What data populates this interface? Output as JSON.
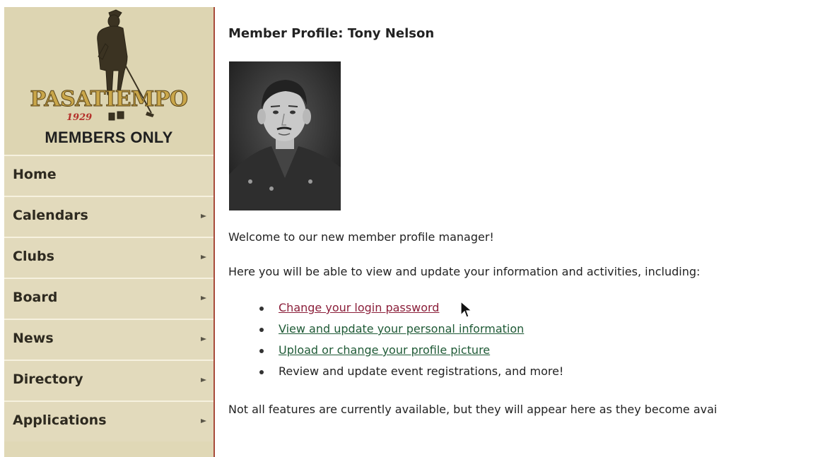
{
  "sidebar": {
    "logo": {
      "wordmark": "PASATIEMPO",
      "year": "1929"
    },
    "members_only": "MEMBERS ONLY",
    "items": [
      {
        "label": "Home",
        "has_submenu": false
      },
      {
        "label": "Calendars",
        "has_submenu": true
      },
      {
        "label": "Clubs",
        "has_submenu": true
      },
      {
        "label": "Board",
        "has_submenu": true
      },
      {
        "label": "News",
        "has_submenu": true
      },
      {
        "label": "Directory",
        "has_submenu": true
      },
      {
        "label": "Applications",
        "has_submenu": true
      }
    ]
  },
  "main": {
    "title": "Member Profile: Tony Nelson",
    "welcome": "Welcome to our new member profile manager!",
    "intro": "Here you will be able to view and update your information and activities, including:",
    "features": [
      {
        "text": "Change your login password",
        "link": true,
        "state": "hover"
      },
      {
        "text": "View and update your personal information",
        "link": true,
        "state": "normal"
      },
      {
        "text": "Upload or change your profile picture",
        "link": true,
        "state": "normal"
      },
      {
        "text": "Review and update event registrations, and more!",
        "link": false,
        "state": "normal"
      }
    ],
    "footer_note": "Not all features are currently available, but they will appear here as they become avai"
  },
  "colors": {
    "sidebar_bg": "#e0d8b6",
    "sidebar_border": "#a84a3a",
    "link_hover": "#8b1f3a",
    "link": "#1f5a36"
  },
  "icons": {
    "nav_arrow": "arrow-right-icon",
    "cursor": "pointer-cursor-icon"
  }
}
